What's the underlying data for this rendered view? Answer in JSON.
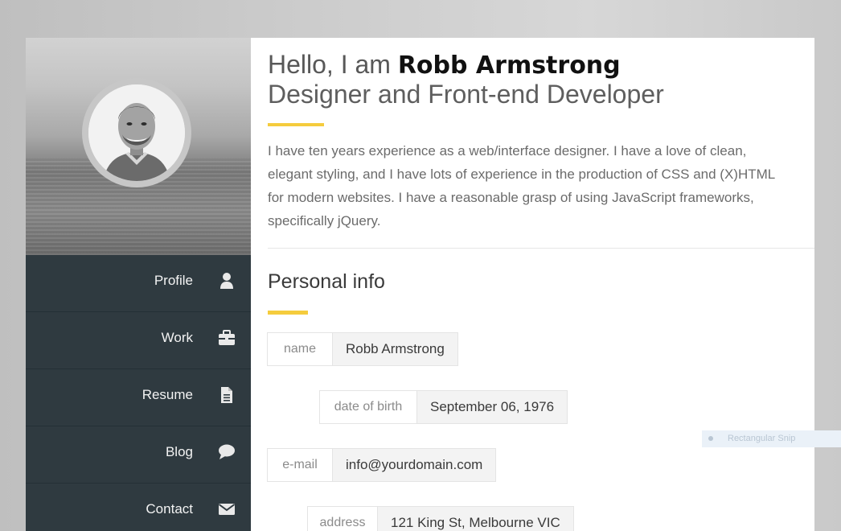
{
  "profile": {
    "greeting": "Hello, I am ",
    "name": "Robb Armstrong",
    "role": "Designer and Front-end Developer",
    "intro": "I have ten years experience as a web/interface designer. I have a love of clean, elegant styling, and I have lots of experience in the production of CSS and (X)HTML for modern websites. I have a reasonable grasp of using JavaScript frameworks, specifically jQuery."
  },
  "nav": {
    "items": [
      {
        "label": "Profile",
        "icon": "user-icon"
      },
      {
        "label": "Work",
        "icon": "briefcase-icon"
      },
      {
        "label": "Resume",
        "icon": "document-icon"
      },
      {
        "label": "Blog",
        "icon": "speech-bubble-icon"
      },
      {
        "label": "Contact",
        "icon": "envelope-icon"
      }
    ]
  },
  "personal": {
    "title": "Personal info",
    "fields": [
      {
        "key": "name",
        "value": "Robb Armstrong"
      },
      {
        "key": "date of birth",
        "value": "September 06, 1976"
      },
      {
        "key": "e-mail",
        "value": "info@yourdomain.com"
      },
      {
        "key": "address",
        "value": "121 King St, Melbourne VIC"
      }
    ]
  },
  "overlay": {
    "snip_label": "Rectangular Snip"
  },
  "colors": {
    "accent": "#f5cc3d",
    "sidebar": "#2f3a40"
  }
}
